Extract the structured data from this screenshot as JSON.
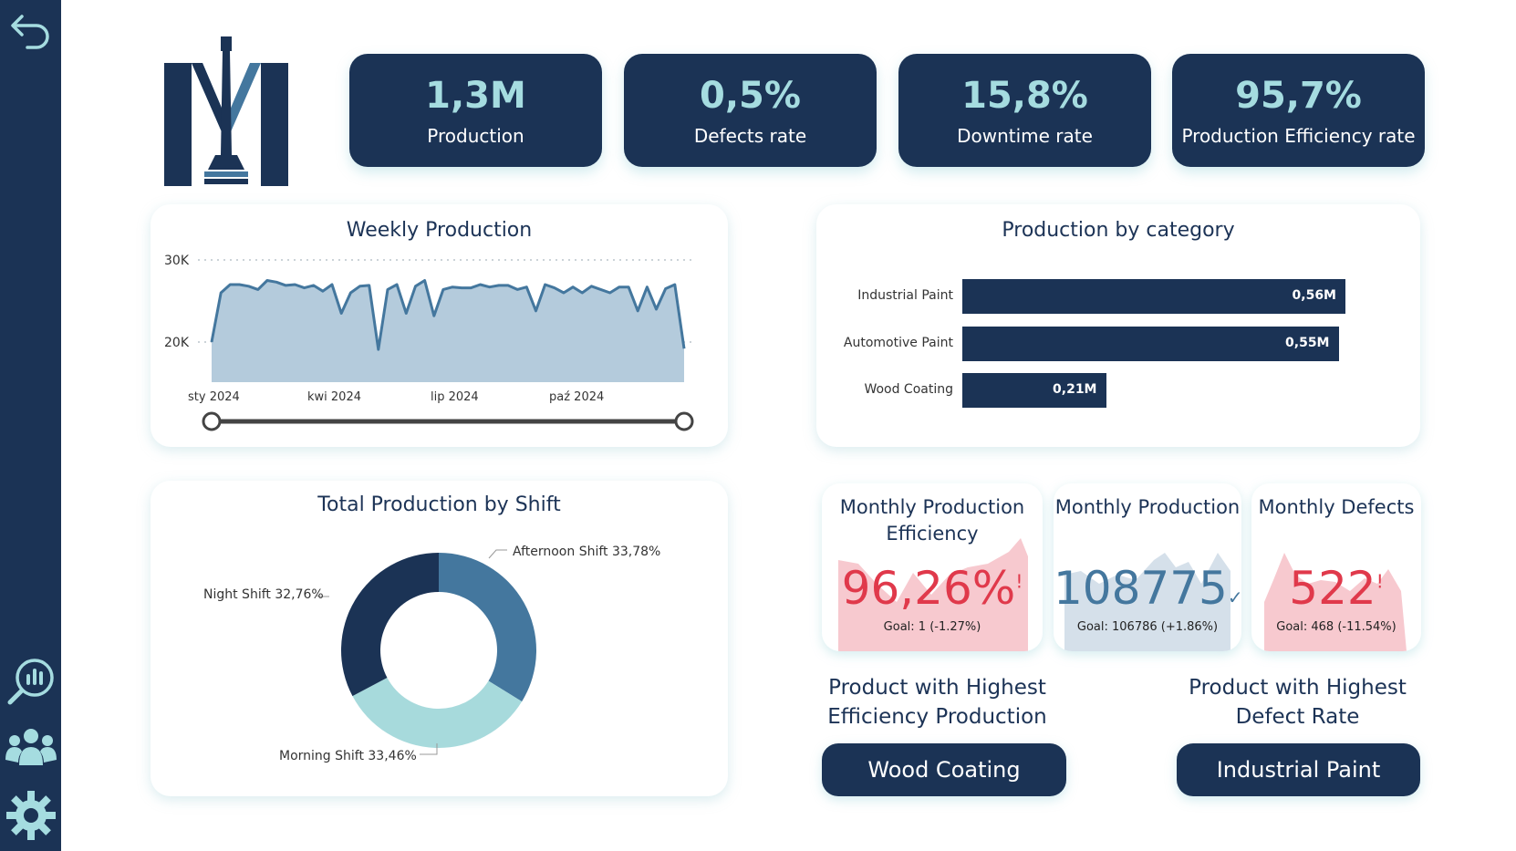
{
  "kpis": [
    {
      "value": "1,3M",
      "label": "Production"
    },
    {
      "value": "0,5%",
      "label": "Defects rate"
    },
    {
      "value": "15,8%",
      "label": "Downtime rate"
    },
    {
      "value": "95,7%",
      "label": "Production Efficiency rate"
    }
  ],
  "weekly": {
    "title": "Weekly Production",
    "y_ticks": [
      "30K",
      "20K"
    ],
    "x_ticks": [
      "sty 2024",
      "kwi 2024",
      "lip 2024",
      "paź 2024"
    ]
  },
  "category": {
    "title": "Production by category",
    "items": [
      {
        "label": "Industrial Paint",
        "value": 0.56,
        "value_label": "0,56M"
      },
      {
        "label": "Automotive Paint",
        "value": 0.55,
        "value_label": "0,55M"
      },
      {
        "label": "Wood Coating",
        "value": 0.21,
        "value_label": "0,21M"
      }
    ]
  },
  "shift": {
    "title": "Total Production by Shift",
    "slices": [
      {
        "label": "Afternoon Shift 33,78%",
        "value": 33.78,
        "color": "#44779e"
      },
      {
        "label": "Morning Shift 33,46%",
        "value": 33.46,
        "color": "#a7dadc"
      },
      {
        "label": "Night Shift 32,76%",
        "value": 32.76,
        "color": "#1b3355"
      }
    ]
  },
  "monthly": [
    {
      "title": "Monthly Production Efficiency",
      "value": "96,26%",
      "mark": "!",
      "goal": "Goal: 1 (-1.27%)",
      "color": "#e0394b"
    },
    {
      "title": "Monthly Production",
      "value": "108775",
      "mark": "✓",
      "goal": "Goal: 106786 (+1.86%)",
      "color": "#44779e"
    },
    {
      "title": "Monthly Defects",
      "value": "522",
      "mark": "!",
      "goal": "Goal: 468 (-11.54%)",
      "color": "#e0394b"
    }
  ],
  "highlights": [
    {
      "title": "Product with Highest Efficiency Production",
      "value": "Wood Coating"
    },
    {
      "title": "Product with Highest Defect Rate",
      "value": "Industrial Paint"
    }
  ],
  "chart_data": [
    {
      "type": "area",
      "title": "Weekly Production",
      "x": [
        "2024-01-01",
        "2024-01-08",
        "2024-01-15",
        "2024-01-22",
        "2024-01-29",
        "2024-02-05",
        "2024-02-12",
        "2024-02-19",
        "2024-02-26",
        "2024-03-04",
        "2024-03-11",
        "2024-03-18",
        "2024-03-25",
        "2024-04-01",
        "2024-04-08",
        "2024-04-15",
        "2024-04-22",
        "2024-04-29",
        "2024-05-06",
        "2024-05-13",
        "2024-05-20",
        "2024-05-27",
        "2024-06-03",
        "2024-06-10",
        "2024-06-17",
        "2024-06-24",
        "2024-07-01",
        "2024-07-08",
        "2024-07-15",
        "2024-07-22",
        "2024-07-29",
        "2024-08-05",
        "2024-08-12",
        "2024-08-19",
        "2024-08-26",
        "2024-09-02",
        "2024-09-09",
        "2024-09-16",
        "2024-09-23",
        "2024-09-30",
        "2024-10-07",
        "2024-10-14",
        "2024-10-21",
        "2024-10-28",
        "2024-11-04",
        "2024-11-11",
        "2024-11-18",
        "2024-11-25",
        "2024-12-02",
        "2024-12-09",
        "2024-12-16",
        "2024-12-23"
      ],
      "values": [
        20000,
        26000,
        27000,
        27000,
        26800,
        26400,
        27500,
        27300,
        26900,
        27000,
        26600,
        26900,
        26200,
        27000,
        23500,
        26000,
        26800,
        26900,
        19100,
        26400,
        27000,
        23500,
        26800,
        27500,
        23200,
        26400,
        26700,
        26600,
        26600,
        27000,
        26700,
        26900,
        26900,
        26400,
        26700,
        23800,
        27000,
        26600,
        26000,
        26700,
        26000,
        26800,
        26400,
        26000,
        26700,
        26700,
        23800,
        26700,
        24000,
        26500,
        27000,
        19200
      ],
      "ylim": [
        17000,
        30000
      ],
      "grid": true
    },
    {
      "type": "bar",
      "title": "Production by category",
      "categories": [
        "Industrial Paint",
        "Automotive Paint",
        "Wood Coating"
      ],
      "values": [
        0.56,
        0.55,
        0.21
      ]
    },
    {
      "type": "pie",
      "title": "Total Production by Shift",
      "categories": [
        "Afternoon Shift",
        "Morning Shift",
        "Night Shift"
      ],
      "values": [
        33.78,
        33.46,
        32.76
      ]
    }
  ]
}
